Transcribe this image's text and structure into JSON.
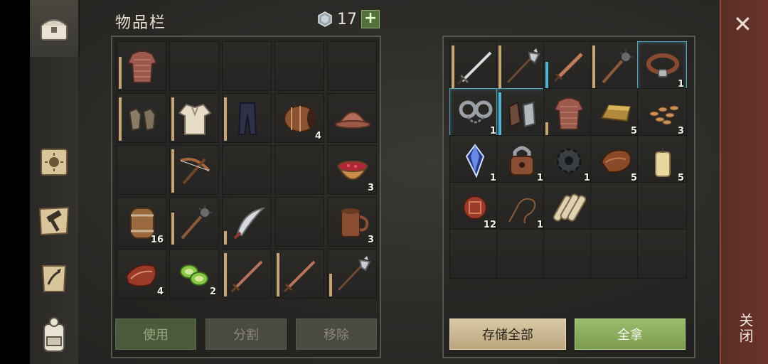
{
  "header": {
    "title": "物品栏",
    "currency_value": "17",
    "plus_label": "+"
  },
  "nav": [
    "chest-icon",
    "skills-book-icon",
    "crafting-hammer-icon",
    "recipe-scroll-icon",
    "backpack-icon"
  ],
  "inventory": {
    "rows": [
      [
        {
          "icon": "chainmail-shirt-icon",
          "count": "",
          "dur": 0.7
        },
        {
          "icon": "",
          "count": "",
          "dur": 0
        },
        {
          "icon": "",
          "count": "",
          "dur": 0
        },
        {
          "icon": "",
          "count": "",
          "dur": 0
        },
        {
          "icon": "",
          "count": "",
          "dur": 0
        }
      ],
      [
        {
          "icon": "gloves-icon",
          "count": "",
          "dur": 0.95
        },
        {
          "icon": "linen-shirt-icon",
          "count": "",
          "dur": 0.95
        },
        {
          "icon": "trousers-icon",
          "count": "",
          "dur": 0.95
        },
        {
          "icon": "barrel-icon",
          "count": "4",
          "dur": 0
        },
        {
          "icon": "helmet-icon",
          "count": "",
          "dur": 0
        }
      ],
      [
        {
          "icon": "",
          "count": "",
          "dur": 0
        },
        {
          "icon": "crossbow-icon",
          "count": "",
          "dur": 0.95
        },
        {
          "icon": "",
          "count": "",
          "dur": 0
        },
        {
          "icon": "",
          "count": "",
          "dur": 0
        },
        {
          "icon": "berry-bowl-icon",
          "count": "3",
          "dur": 0
        }
      ],
      [
        {
          "icon": "keg-icon",
          "count": "16",
          "dur": 0
        },
        {
          "icon": "mace-icon",
          "count": "",
          "dur": 0.7
        },
        {
          "icon": "scimitar-icon",
          "count": "",
          "dur": 0.3
        },
        {
          "icon": "",
          "count": "",
          "dur": 0
        },
        {
          "icon": "mug-icon",
          "count": "3",
          "dur": 0
        }
      ],
      [
        {
          "icon": "meat-icon",
          "count": "4",
          "dur": 0
        },
        {
          "icon": "cucumber-slices-icon",
          "count": "2",
          "dur": 0
        },
        {
          "icon": "sword-icon",
          "count": "",
          "dur": 0.95
        },
        {
          "icon": "sword-icon",
          "count": "",
          "dur": 0.95
        },
        {
          "icon": "halberd-icon",
          "count": "",
          "dur": 0.5
        }
      ]
    ],
    "buttons": {
      "use": "使用",
      "split": "分割",
      "remove": "移除"
    }
  },
  "storage": {
    "rows": [
      [
        {
          "icon": "longsword-icon",
          "count": "",
          "dur": 0.95,
          "blue": false,
          "hl": false
        },
        {
          "icon": "halberd-icon",
          "count": "",
          "dur": 0.95,
          "blue": false,
          "hl": false
        },
        {
          "icon": "dagger-icon",
          "count": "",
          "dur": 0.6,
          "blue": true,
          "hl": false
        },
        {
          "icon": "mace-icon",
          "count": "",
          "dur": 0.95,
          "blue": false,
          "hl": false
        },
        {
          "icon": "collar-icon",
          "count": "1",
          "dur": 0,
          "blue": false,
          "hl": true
        }
      ],
      [
        {
          "icon": "shackles-icon",
          "count": "1",
          "dur": 0,
          "blue": false,
          "hl": true
        },
        {
          "icon": "gauntlets-icon",
          "count": "",
          "dur": 0.95,
          "blue": true,
          "hl": true
        },
        {
          "icon": "chainmail-shirt-icon",
          "count": "",
          "dur": 0.3,
          "blue": false,
          "hl": false
        },
        {
          "icon": "gold-ingot-icon",
          "count": "5",
          "dur": 0,
          "blue": false,
          "hl": false
        },
        {
          "icon": "seeds-icon",
          "count": "3",
          "dur": 0,
          "blue": false,
          "hl": false
        }
      ],
      [
        {
          "icon": "crystal-icon",
          "count": "1",
          "dur": 0,
          "blue": false,
          "hl": false
        },
        {
          "icon": "padlock-icon",
          "count": "1",
          "dur": 0,
          "blue": false,
          "hl": false
        },
        {
          "icon": "gear-icon",
          "count": "1",
          "dur": 0,
          "blue": false,
          "hl": false
        },
        {
          "icon": "leather-icon",
          "count": "5",
          "dur": 0,
          "blue": false,
          "hl": false
        },
        {
          "icon": "candle-icon",
          "count": "5",
          "dur": 0,
          "blue": false,
          "hl": false
        }
      ],
      [
        {
          "icon": "rope-tangle-icon",
          "count": "12",
          "dur": 0,
          "blue": false,
          "hl": false
        },
        {
          "icon": "whip-icon",
          "count": "1",
          "dur": 0,
          "blue": false,
          "hl": false
        },
        {
          "icon": "scroll-bundle-icon",
          "count": "",
          "dur": 0,
          "blue": false,
          "hl": false
        },
        {
          "icon": "",
          "count": "",
          "dur": 0,
          "blue": false,
          "hl": false
        },
        {
          "icon": "",
          "count": "",
          "dur": 0,
          "blue": false,
          "hl": false
        }
      ],
      [
        {
          "icon": "",
          "count": "",
          "dur": 0,
          "blue": false,
          "hl": false
        },
        {
          "icon": "",
          "count": "",
          "dur": 0,
          "blue": false,
          "hl": false
        },
        {
          "icon": "",
          "count": "",
          "dur": 0,
          "blue": false,
          "hl": false
        },
        {
          "icon": "",
          "count": "",
          "dur": 0,
          "blue": false,
          "hl": false
        },
        {
          "icon": "",
          "count": "",
          "dur": 0,
          "blue": false,
          "hl": false
        }
      ]
    ],
    "buttons": {
      "store_all": "存储全部",
      "take_all": "全拿"
    }
  },
  "close": {
    "x": "✕",
    "label": "关闭"
  }
}
